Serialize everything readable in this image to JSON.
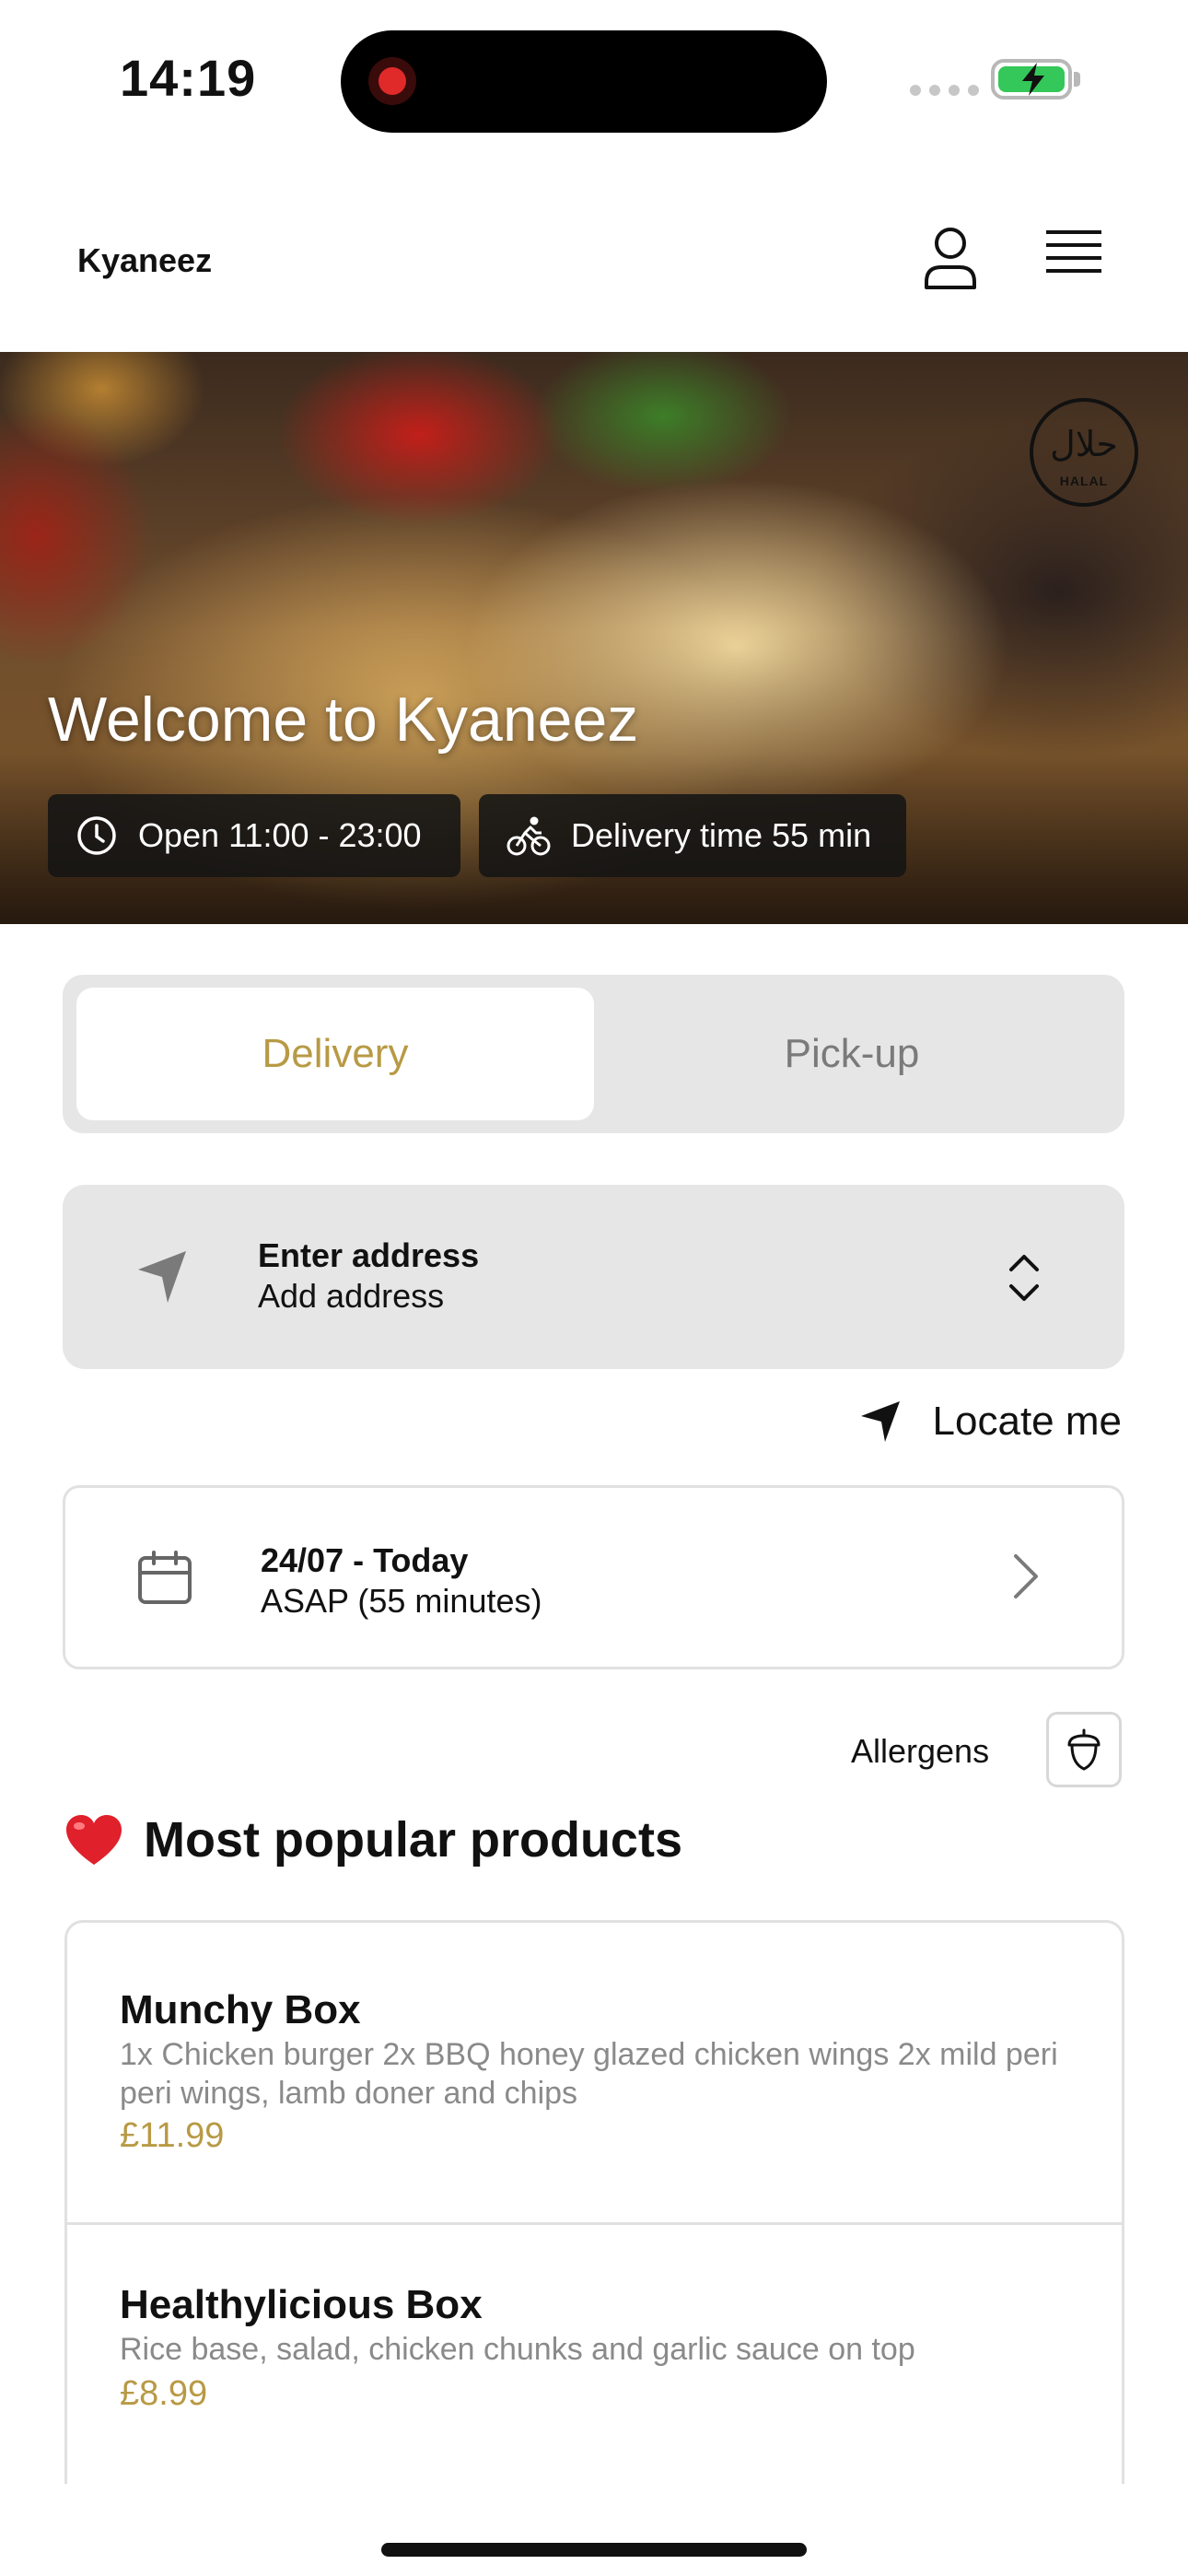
{
  "status_bar": {
    "time": "14:19"
  },
  "header": {
    "brand": "Kyaneez"
  },
  "hero": {
    "title": "Welcome to Kyaneez",
    "badge_arabic": "حلال",
    "badge_latin": "HALAL",
    "open_hours": "Open 11:00 - 23:00",
    "delivery_time": "Delivery time 55 min"
  },
  "order_mode": {
    "tabs": [
      "Delivery",
      "Pick-up"
    ],
    "selected": "Delivery"
  },
  "address": {
    "title": "Enter address",
    "subtitle": "Add address"
  },
  "locate": {
    "label": "Locate me"
  },
  "schedule": {
    "date": "24/07 - Today",
    "time": "ASAP (55 minutes)"
  },
  "allergens": {
    "label": "Allergens"
  },
  "popular": {
    "heading": "Most popular products",
    "products": [
      {
        "name": "Munchy Box",
        "description": "1x Chicken burger 2x BBQ honey glazed chicken wings 2x mild peri peri wings, lamb doner and chips",
        "price": "£11.99"
      },
      {
        "name": "Healthylicious Box",
        "description": "Rice base, salad, chicken chunks and garlic sauce on top",
        "price": "£8.99"
      }
    ]
  },
  "colors": {
    "accent": "#b89a45",
    "muted_bg": "#e6e6e6",
    "border": "#e1e1e1"
  },
  "icons": [
    "record-icon",
    "signal-icon",
    "battery-icon",
    "user-icon",
    "menu-icon",
    "halal-badge-icon",
    "clock-icon",
    "bike-icon",
    "navigation-arrow-icon",
    "chevron-up-down-icon",
    "calendar-icon",
    "chevron-right-icon",
    "acorn-icon",
    "heart-icon"
  ]
}
